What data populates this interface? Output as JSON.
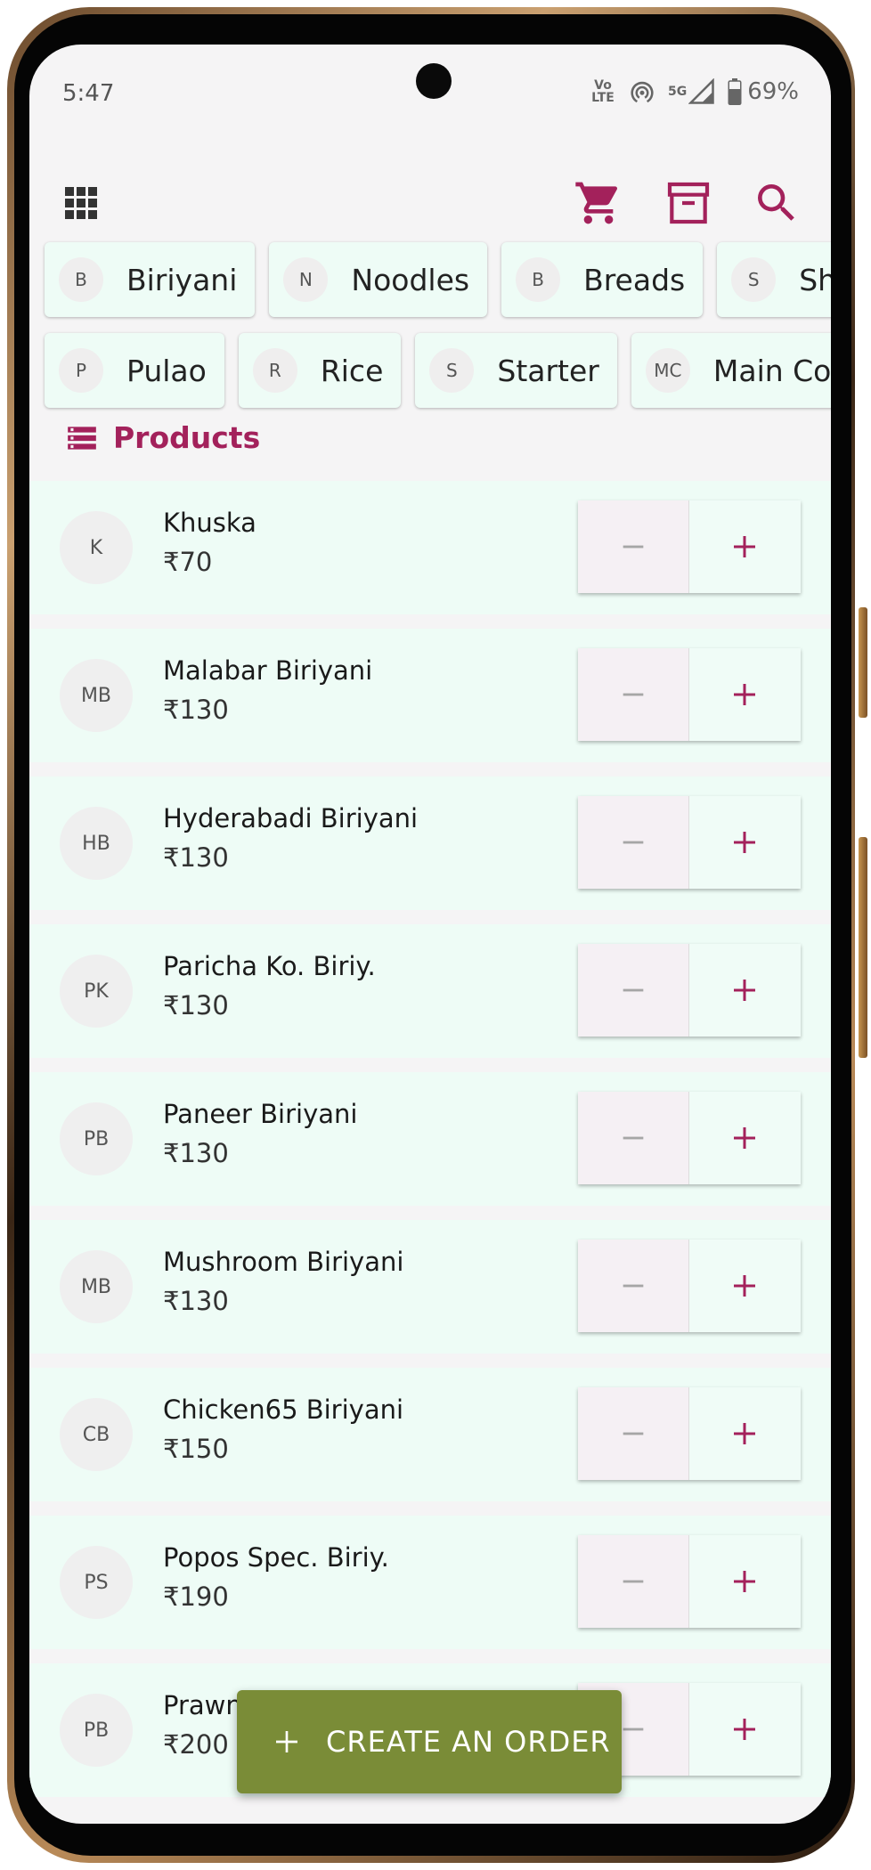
{
  "status_bar": {
    "time": "5:47",
    "volte_label": "Vo LTE",
    "network_label": "5G",
    "battery": "69%"
  },
  "toolbar": {
    "menu_icon": "apps-grid-icon",
    "cart_icon": "cart-icon",
    "archive_icon": "archive-icon",
    "search_icon": "search-icon",
    "accent_color": "#a3215b"
  },
  "categories_row1": [
    {
      "initial": "B",
      "label": "Biriyani"
    },
    {
      "initial": "N",
      "label": "Noodles"
    },
    {
      "initial": "B",
      "label": "Breads"
    },
    {
      "initial": "S",
      "label": "Shawarma"
    }
  ],
  "categories_row2": [
    {
      "initial": "P",
      "label": "Pulao"
    },
    {
      "initial": "R",
      "label": "Rice"
    },
    {
      "initial": "S",
      "label": "Starter"
    },
    {
      "initial": "MC",
      "label": "Main Course"
    }
  ],
  "products_section": {
    "title": "Products",
    "icon": "storage-icon"
  },
  "products": [
    {
      "initials": "K",
      "name": "Khuska",
      "price": "₹70"
    },
    {
      "initials": "MB",
      "name": "Malabar Biriyani",
      "price": "₹130"
    },
    {
      "initials": "HB",
      "name": "Hyderabadi Biriyani",
      "price": "₹130"
    },
    {
      "initials": "PK",
      "name": "Paricha Ko. Biriy.",
      "price": "₹130"
    },
    {
      "initials": "PB",
      "name": "Paneer Biriyani",
      "price": "₹130"
    },
    {
      "initials": "MB",
      "name": "Mushroom Biriyani",
      "price": "₹130"
    },
    {
      "initials": "CB",
      "name": "Chicken65 Biriyani",
      "price": "₹150"
    },
    {
      "initials": "PS",
      "name": "Popos Spec. Biriy.",
      "price": "₹190"
    },
    {
      "initials": "PB",
      "name": "Prawn",
      "price": "₹200"
    }
  ],
  "fab": {
    "label": "CREATE AN ORDER",
    "color": "#7a8c37"
  }
}
